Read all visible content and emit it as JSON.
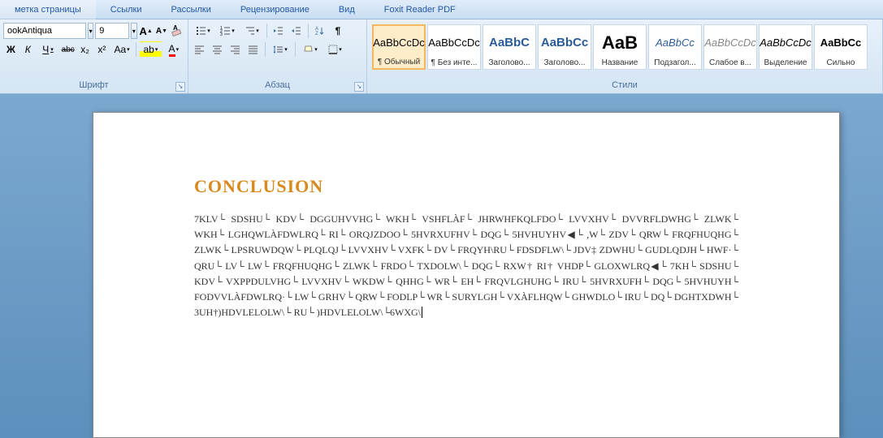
{
  "menu": {
    "items": [
      "метка страницы",
      "Ссылки",
      "Рассылки",
      "Рецензирование",
      "Вид",
      "Foxit Reader PDF"
    ]
  },
  "font": {
    "name": "ookAntiqua",
    "size": "9",
    "grow_label": "A▲",
    "shrink_label": "A▼",
    "clear_label": "Aa",
    "bold": "Ж",
    "italic": "К",
    "underline": "Ч",
    "strike": "abc",
    "sub": "x₂",
    "sup": "x²",
    "case": "Aa",
    "highlight": "ab",
    "color": "A",
    "group_label": "Шрифт"
  },
  "para": {
    "group_label": "Абзац"
  },
  "styles": {
    "group_label": "Стили",
    "items": [
      {
        "preview": "AaBbCcDc",
        "label": "¶ Обычный",
        "color": "#000",
        "bold": false,
        "active": true
      },
      {
        "preview": "AaBbCcDc",
        "label": "¶ Без инте...",
        "color": "#000",
        "bold": false,
        "active": false
      },
      {
        "preview": "AaBbC",
        "label": "Заголово...",
        "color": "#2a5c9a",
        "bold": true,
        "active": false
      },
      {
        "preview": "AaBbCc",
        "label": "Заголово...",
        "color": "#2a5c9a",
        "bold": true,
        "active": false
      },
      {
        "preview": "AaB",
        "label": "Название",
        "color": "#000",
        "bold": true,
        "active": false
      },
      {
        "preview": "AaBbCc",
        "label": "Подзагол...",
        "color": "#2a5c9a",
        "bold": false,
        "active": false,
        "italic": true
      },
      {
        "preview": "AaBbCcDc",
        "label": "Слабое в...",
        "color": "#888",
        "bold": false,
        "active": false,
        "italic": true
      },
      {
        "preview": "AaBbCcDc",
        "label": "Выделение",
        "color": "#000",
        "bold": false,
        "active": false,
        "italic": true
      },
      {
        "preview": "AaBbCc",
        "label": "Сильно",
        "color": "#000",
        "bold": true,
        "active": false
      }
    ]
  },
  "doc": {
    "heading": "CONCLUSION",
    "body": "7KLV└ SDSHU└ KDV└ DGGUHVVHG└ WKH└ VSHFLÀF└ JHRWHFKQLFDO└ LVVXHV└ DVVRFLDWHG└ ZLWK└ WKH└ LGHQWLÀFDWLRQ└ RI└ ORQJZDOO└ 5HVRXUFHV└ DQG└ 5HVHUYHV◀└ ,W└ ZDV└ QRW└ FRQFHUQHG└ ZLWK└ LPSRUWDQW└ PLQLQJ└ LVVXHV└ VXFK└ DV└ FRQYH\\RU└ FDSDFLW\\└ JDV‡ ZDWHU└ GUDLQDJH└ HWF·└ QRU└ LV└ LW└ FRQFHUQHG└ ZLWK└ FRDO└ TXDOLW\\└ DQG└ RXW† RI† VHDP└ GLOXWLRQ◀└ 7KH└ SDSHU└ KDV└ VXPPDULVHG└ LVVXHV└ WKDW└ QHHG└ WR└ EH└ FRQVLGHUHG└ IRU└ 5HVRXUFH└ DQG└ 5HVHUYH└ FODVVLÀFDWLRQ·└ LW└ GRHV└ QRW└ FODLP└ WR└ SURYLGH└ VXÀFLHQW└ GHWDLO└ IRU└ DQ└ DGHTXDWH└ 3UH†)HDVLELOLW\\└ RU└ )HDVLELOLW\\└6WXG\\"
  }
}
